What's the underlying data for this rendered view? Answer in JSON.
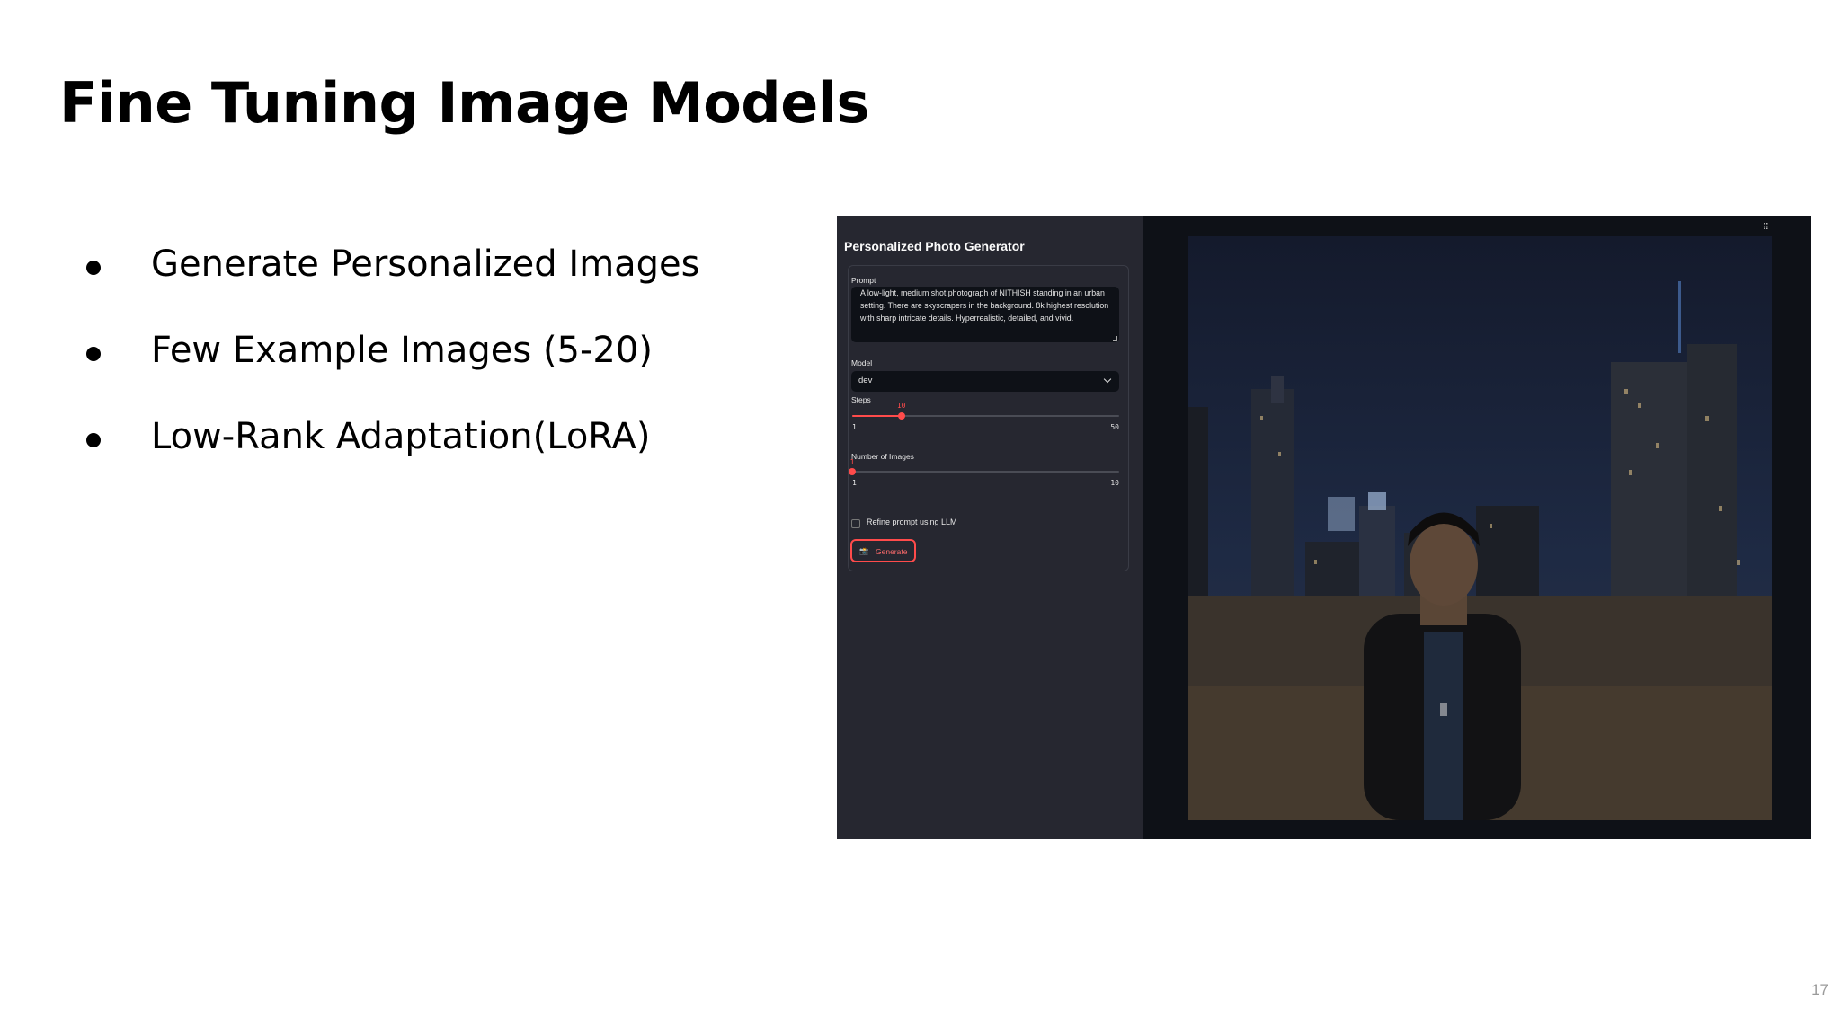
{
  "slide": {
    "title": "Fine Tuning Image Models",
    "bullets": [
      "Generate Personalized Images",
      "Few Example Images (5-20)",
      "Low-Rank Adaptation(LoRA)"
    ],
    "page_number": "17"
  },
  "app": {
    "title": "Personalized Photo Generator",
    "prompt": {
      "label": "Prompt",
      "value": "A low-light, medium shot photograph of NITHISH standing in an urban setting. There are skyscrapers in the background. 8k highest resolution with sharp intricate details. Hyperrealistic, detailed, and vivid."
    },
    "model": {
      "label": "Model",
      "selected": "dev"
    },
    "steps": {
      "label": "Steps",
      "value": "10",
      "min": "1",
      "max": "50",
      "fraction": 0.184
    },
    "num_images": {
      "label": "Number of Images",
      "value": "1",
      "min": "1",
      "max": "10",
      "fraction": 0
    },
    "refine": {
      "label": "Refine prompt using LLM",
      "checked": false
    },
    "generate": {
      "label": "Generate",
      "icon": "camera-icon"
    },
    "menu_icon": "drag-dots-icon",
    "colors": {
      "accent": "#ff4b4b",
      "sidebar_bg": "#262730",
      "main_bg": "#0e1117"
    }
  }
}
